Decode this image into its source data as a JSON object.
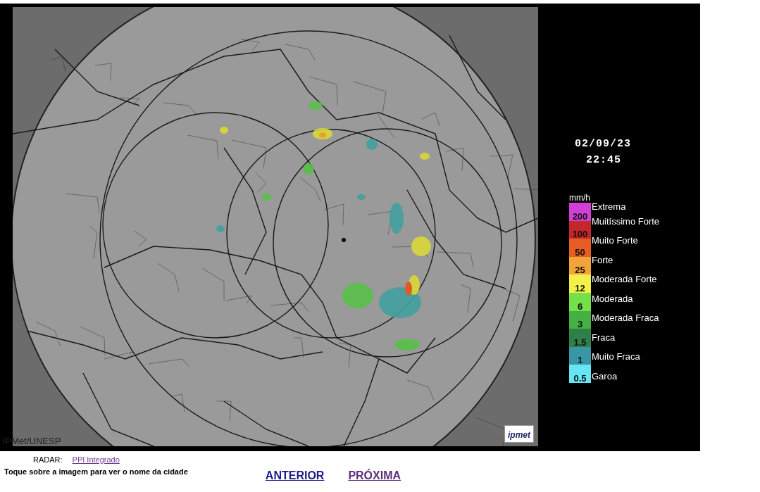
{
  "radar_image": {
    "date": "02/09/23",
    "time": "22:45",
    "credit": "IPMet/UNESP",
    "logo": "ipmet"
  },
  "legend": {
    "unit": "mm/h",
    "scale": [
      {
        "value": "200",
        "color": "#d23fd6"
      },
      {
        "value": "100",
        "color": "#c4262a"
      },
      {
        "value": "50",
        "color": "#e85d24"
      },
      {
        "value": "25",
        "color": "#f2a33a"
      },
      {
        "value": "12",
        "color": "#f4f04a"
      },
      {
        "value": "6",
        "color": "#74e04a"
      },
      {
        "value": "3",
        "color": "#44b044"
      },
      {
        "value": "1.5",
        "color": "#2f7f48"
      },
      {
        "value": "1",
        "color": "#3996a6"
      },
      {
        "value": "0.5",
        "color": "#66e6f2"
      }
    ],
    "categories": [
      "Extrema",
      "Muitíssimo Forte",
      "Muito Forte",
      "Forte",
      "Moderada Forte",
      "Moderada",
      "Moderada Fraca",
      "Fraca",
      "Muito Fraca",
      "Garoa"
    ]
  },
  "radar": {
    "label": "RADAR:",
    "link": "PPI Integrado"
  },
  "instruction": "Toque sobre a imagem para ver o nome da cidade",
  "nav": [
    {
      "label": "ANTERIOR",
      "visited": false
    },
    {
      "label": "PRÓXIMA",
      "visited": true
    }
  ]
}
